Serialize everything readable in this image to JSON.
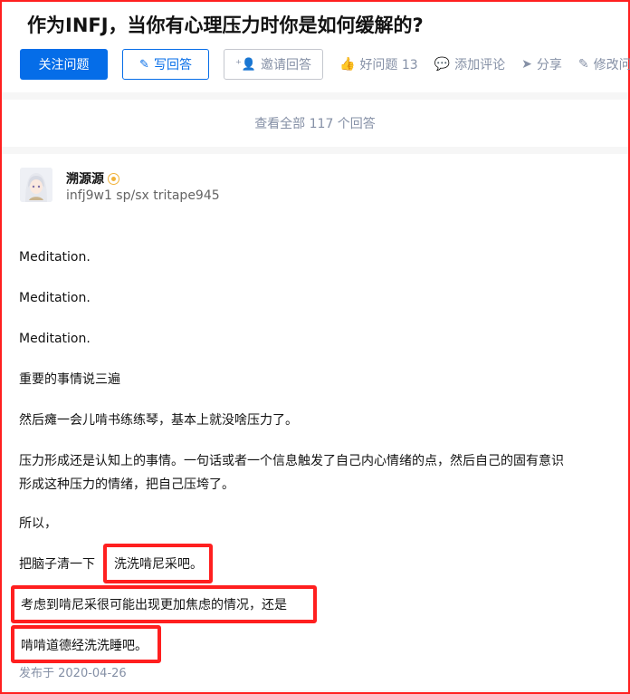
{
  "question": {
    "title": "作为INFJ，当你有心理压力时你是如何缓解的?"
  },
  "actions": {
    "follow_label": "关注问题",
    "write_label": "写回答",
    "invite_label": "邀请回答",
    "good_question_label": "好问题 13",
    "comment_label": "添加评论",
    "share_label": "分享",
    "edit_label": "修改问"
  },
  "view_all": "查看全部 117 个回答",
  "answer": {
    "author_name": "溯源源",
    "author_bio": "infj9w1 sp/sx tritape945",
    "paragraphs": [
      "Meditation.",
      "Meditation.",
      "Meditation.",
      "重要的事情说三遍",
      "然后瘫一会儿啃书练练琴，基本上就没啥压力了。",
      "压力形成还是认知上的事情。一句话或者一个信息触发了自己内心情绪的点，然后自己的固有意识",
      "形成这种压力的情绪，把自己压垮了。",
      "所以，"
    ],
    "line_prefix": "把脑子清一下",
    "highlight_1": "洗洗啃尼采吧。",
    "highlight_2": "考虑到啃尼采很可能出现更加焦虑的情况，还是",
    "highlight_3": "啃啃道德经洗洗睡吧。",
    "published": "发布于 2020-04-26"
  },
  "colors": {
    "primary": "#056de8",
    "highlight_border": "#ff1f1f",
    "muted": "#8590a6"
  },
  "icons": [
    "pencil-icon",
    "invite-user-icon",
    "thumbs-up-icon",
    "comment-icon",
    "share-icon",
    "edit-icon",
    "author-badge-icon"
  ]
}
